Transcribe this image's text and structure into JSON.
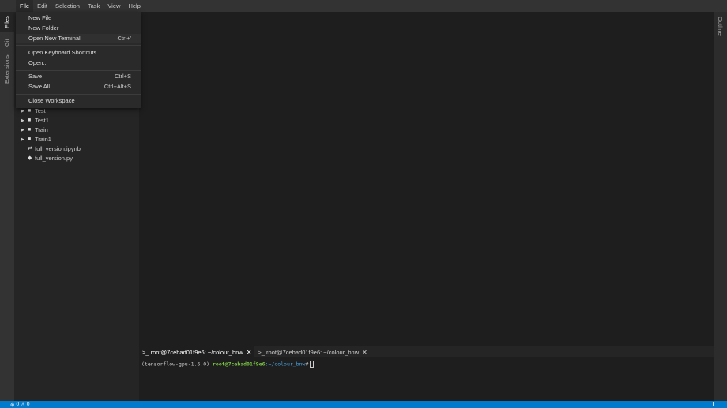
{
  "menubar": [
    "File",
    "Edit",
    "Selection",
    "Task",
    "View",
    "Help"
  ],
  "file_menu": [
    {
      "label": "New File",
      "shortcut": ""
    },
    {
      "label": "New Folder",
      "shortcut": ""
    },
    {
      "label": "Open New Terminal",
      "shortcut": "Ctrl+'"
    },
    {
      "label": "Open Keyboard Shortcuts",
      "shortcut": ""
    },
    {
      "label": "Open...",
      "shortcut": ""
    },
    {
      "label": "Save",
      "shortcut": "Ctrl+S"
    },
    {
      "label": "Save All",
      "shortcut": "Ctrl+Alt+S"
    },
    {
      "label": "Close Workspace",
      "shortcut": ""
    }
  ],
  "left_tabs": [
    "Files",
    "Git",
    "Extensions"
  ],
  "right_tabs": [
    "Outline"
  ],
  "files": [
    {
      "name": "Test",
      "type": "folder"
    },
    {
      "name": "Test1",
      "type": "folder"
    },
    {
      "name": "Train",
      "type": "folder"
    },
    {
      "name": "Train1",
      "type": "folder"
    },
    {
      "name": "full_version.ipynb",
      "type": "notebook"
    },
    {
      "name": "full_version.py",
      "type": "python"
    }
  ],
  "terminal": {
    "tabs": [
      ">_ root@7cebad01f9e6: ~/colour_bnw",
      ">_ root@7cebad01f9e6: ~/colour_bnw"
    ],
    "env": "(tensorflow-gpu-1.6.0)",
    "user": "root@7cebad01f9e6",
    "path": ":~/colour_bnw",
    "prompt": "#"
  },
  "status": {
    "errors": "0",
    "warnings": "0"
  },
  "colors": {
    "status_bar": "#007acc",
    "prompt_user": "#7cc744",
    "prompt_path": "#4aa3e0"
  }
}
